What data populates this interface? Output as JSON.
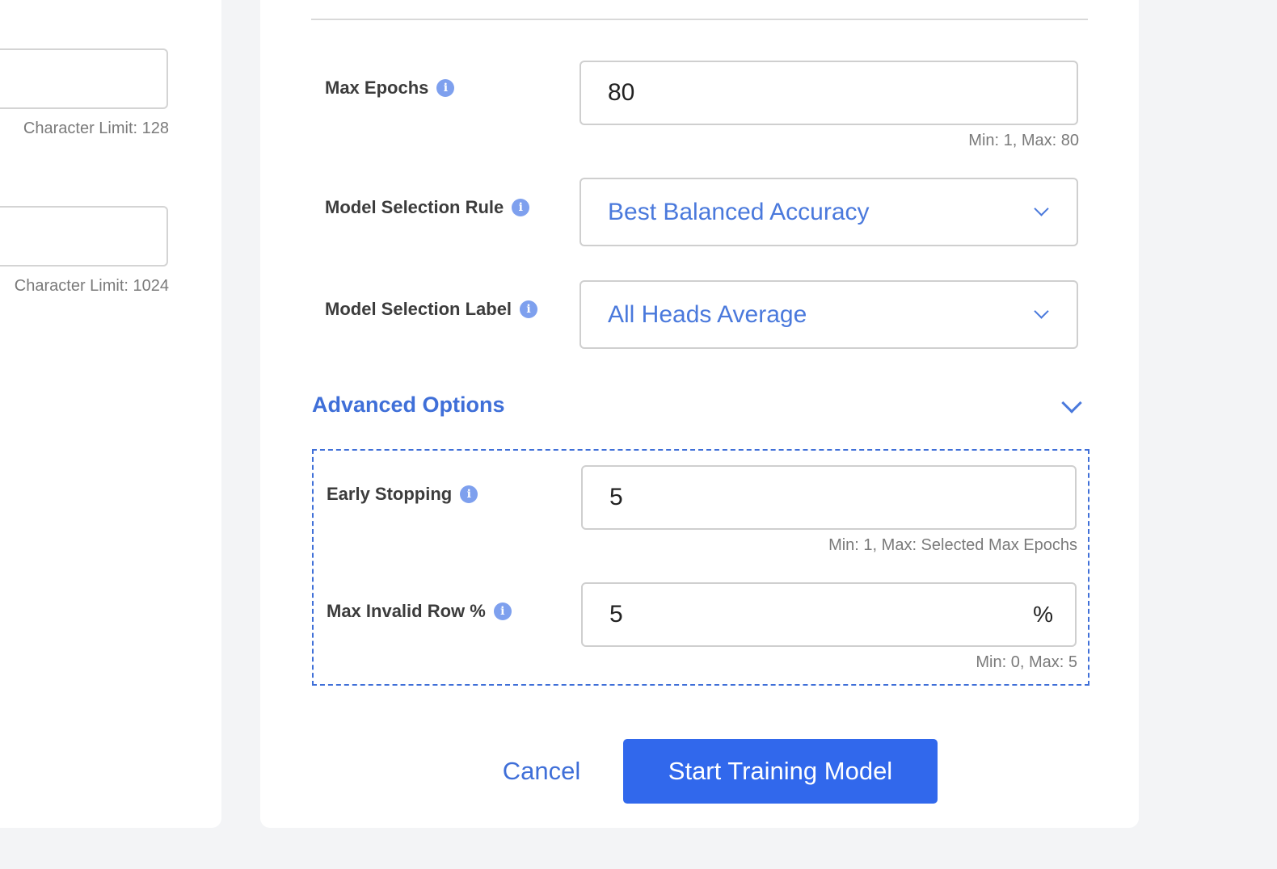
{
  "left_panel": {
    "field1_hint": "Character Limit: 128",
    "field2_hint": "Character Limit: 1024"
  },
  "form": {
    "max_epochs": {
      "label": "Max Epochs",
      "value": "80",
      "hint": "Min: 1, Max: 80"
    },
    "model_selection_rule": {
      "label": "Model Selection Rule",
      "value": "Best Balanced Accuracy"
    },
    "model_selection_label": {
      "label": "Model Selection Label",
      "value": "All Heads Average"
    }
  },
  "advanced": {
    "title": "Advanced Options",
    "early_stopping": {
      "label": "Early Stopping",
      "value": "5",
      "hint": "Min: 1, Max: Selected Max Epochs"
    },
    "max_invalid_row": {
      "label": "Max Invalid Row %",
      "value": "5",
      "suffix": "%",
      "hint": "Min: 0, Max: 5"
    }
  },
  "actions": {
    "cancel_label": "Cancel",
    "start_label": "Start Training Model"
  },
  "icons": {
    "info": "info-icon",
    "chevron": "chevron-down-icon"
  },
  "colors": {
    "primary": "#3168ec",
    "link": "#3f6fd8",
    "info_icon": "#7ea0ee"
  }
}
